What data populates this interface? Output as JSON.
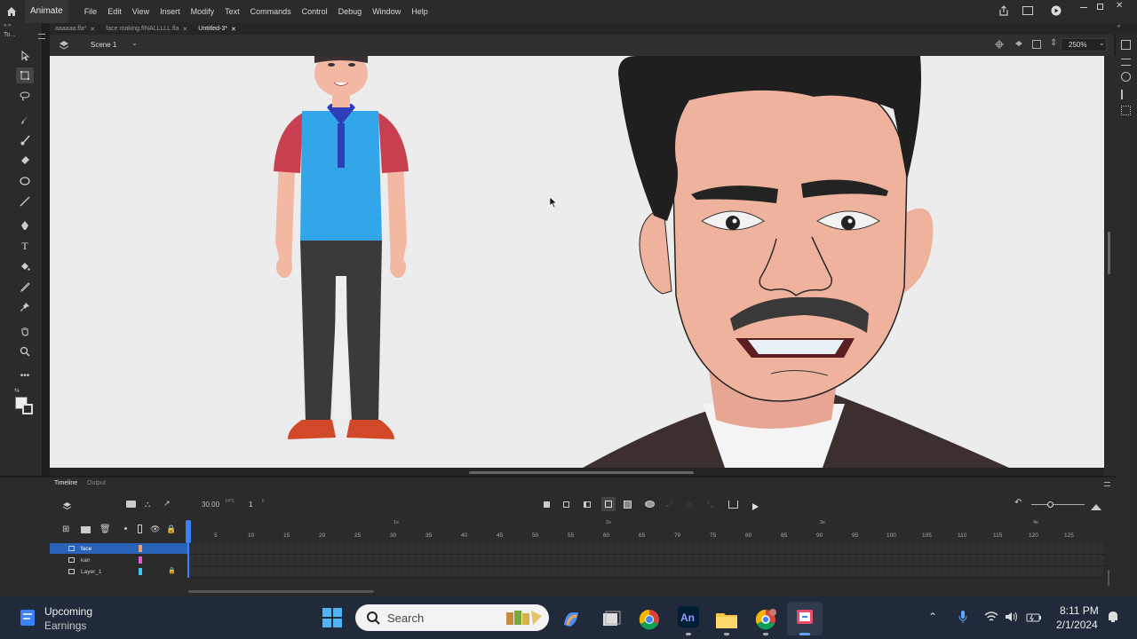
{
  "app": {
    "name": "Animate",
    "menus": [
      "File",
      "Edit",
      "View",
      "Insert",
      "Modify",
      "Text",
      "Commands",
      "Control",
      "Debug",
      "Window",
      "Help"
    ]
  },
  "tabs": [
    {
      "label": "aaaaaa.fla*",
      "active": false
    },
    {
      "label": "face making.fINALLLLL.fla",
      "active": false
    },
    {
      "label": "Untitled-3*",
      "active": true
    }
  ],
  "tools_header": "To...",
  "scene": {
    "label": "Scene 1",
    "zoom": "250%"
  },
  "timeline": {
    "tab_timeline": "Timeline",
    "tab_output": "Output",
    "fps": "30.00",
    "fps_unit": "FPS",
    "frame": "1",
    "frame_unit": "F",
    "second_markers": [
      "1s",
      "2s",
      "3s",
      "4s"
    ],
    "ticks": [
      "5",
      "10",
      "15",
      "20",
      "25",
      "30",
      "35",
      "40",
      "45",
      "50",
      "55",
      "60",
      "65",
      "70",
      "75",
      "80",
      "85",
      "90",
      "95",
      "100",
      "105",
      "110",
      "115",
      "120",
      "125"
    ],
    "layers": [
      {
        "name": "face",
        "color": "#f0a070",
        "selected": true,
        "locked": false
      },
      {
        "name": "kan",
        "color": "#e060d0",
        "selected": false,
        "locked": false
      },
      {
        "name": "Layer_1",
        "color": "#40c8f0",
        "selected": false,
        "locked": true
      }
    ]
  },
  "taskbar": {
    "widget_title": "Upcoming",
    "widget_subtitle": "Earnings",
    "search_placeholder": "Search",
    "time": "8:11 PM",
    "date": "2/1/2024"
  },
  "colors": {
    "accent": "#3b82f6",
    "stage": "#ececec",
    "layer_selected": "#2a62b8"
  }
}
